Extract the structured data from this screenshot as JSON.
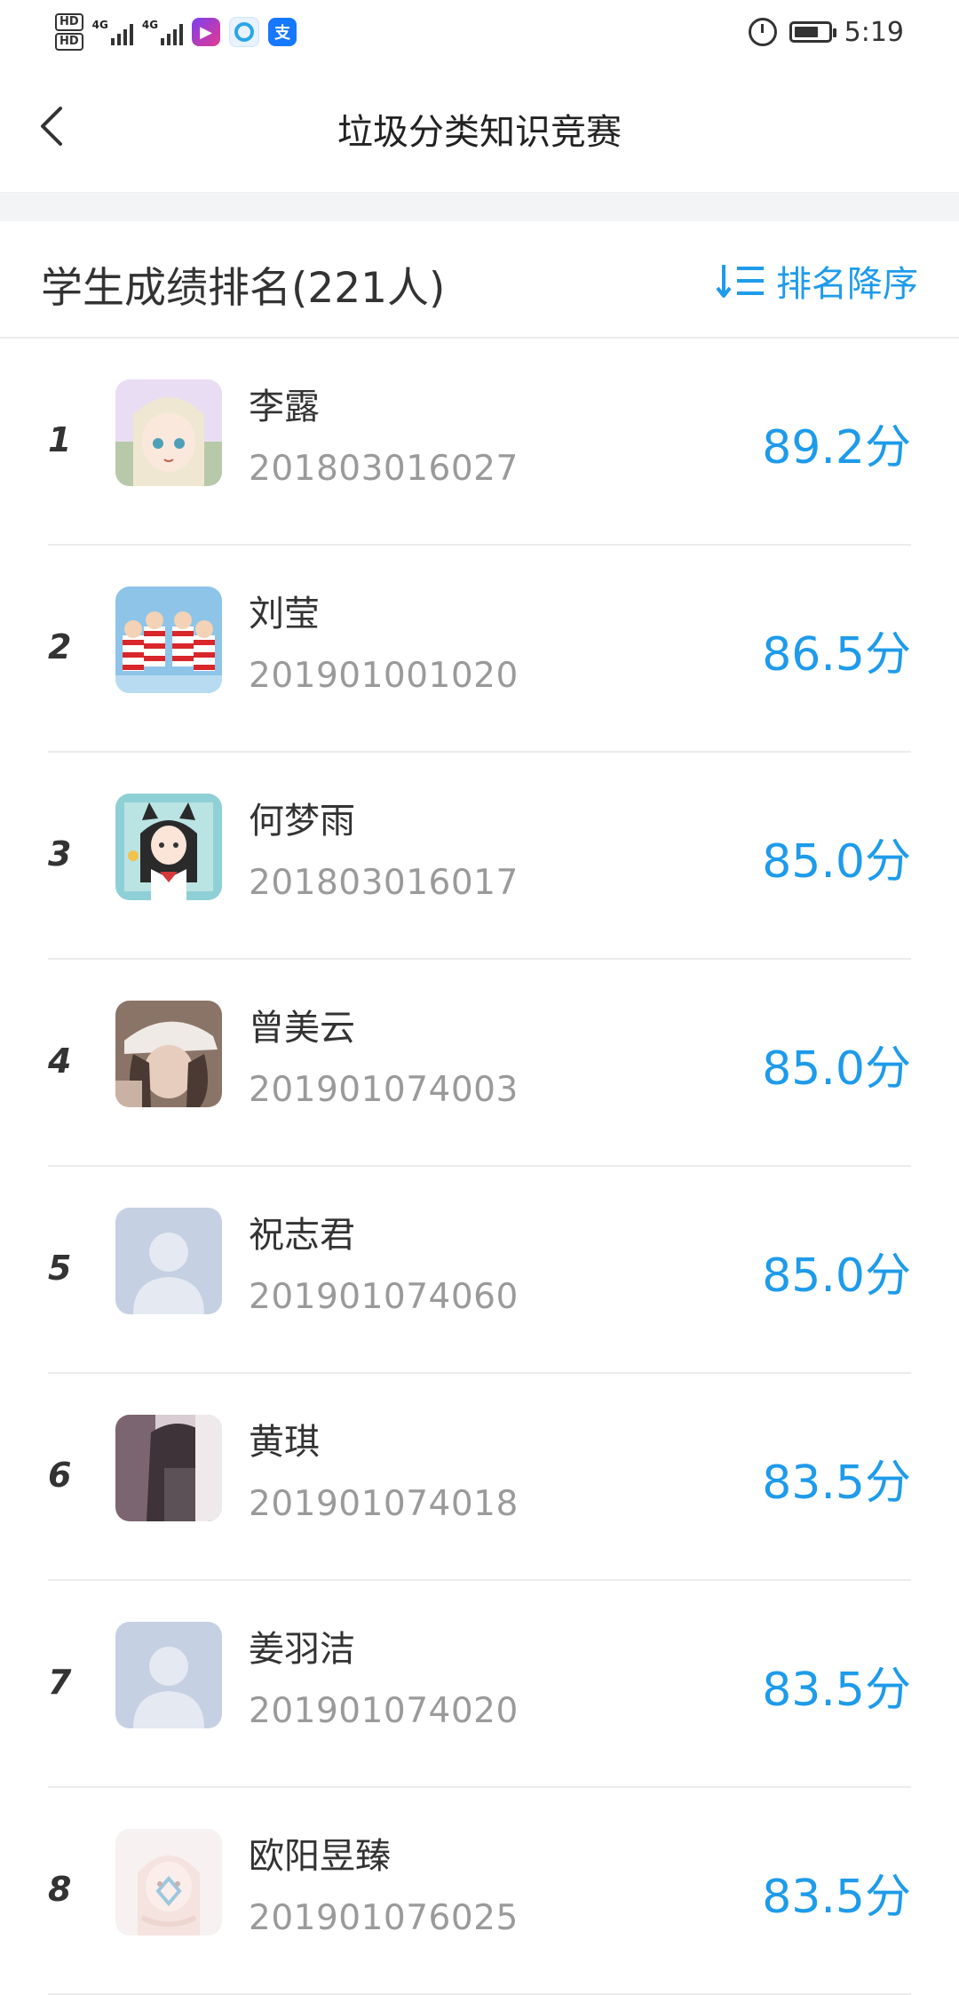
{
  "status_bar": {
    "hd1": "HD",
    "hd2": "HD",
    "net1": "4G",
    "net2": "4G",
    "time": "5:19"
  },
  "nav": {
    "title": "垃圾分类知识竞赛",
    "back_icon": "back-chevron-icon"
  },
  "ranking": {
    "title": "学生成绩排名(221人)",
    "sort_label": "排名降序",
    "sort_icon": "sort-descending-icon",
    "accent_color": "#1e9bea"
  },
  "students": [
    {
      "rank": "1",
      "name": "李露",
      "id": "201803016027",
      "score": "89.2分",
      "avatar": "anime-girl-avatar"
    },
    {
      "rank": "2",
      "name": "刘莹",
      "id": "201901001020",
      "score": "86.5分",
      "avatar": "striped-characters-avatar"
    },
    {
      "rank": "3",
      "name": "何梦雨",
      "id": "201803016017",
      "score": "85.0分",
      "avatar": "cat-ear-girl-avatar"
    },
    {
      "rank": "4",
      "name": "曾美云",
      "id": "201901074003",
      "score": "85.0分",
      "avatar": "photo-girl-cap-avatar"
    },
    {
      "rank": "5",
      "name": "祝志君",
      "id": "201901074060",
      "score": "85.0分",
      "avatar": "default-user-avatar"
    },
    {
      "rank": "6",
      "name": "黄琪",
      "id": "201901074018",
      "score": "83.5分",
      "avatar": "photo-dark-avatar"
    },
    {
      "rank": "7",
      "name": "姜羽洁",
      "id": "201901074020",
      "score": "83.5分",
      "avatar": "default-user-avatar"
    },
    {
      "rank": "8",
      "name": "欧阳昱臻",
      "id": "201901076025",
      "score": "83.5分",
      "avatar": "faded-anime-avatar"
    }
  ]
}
